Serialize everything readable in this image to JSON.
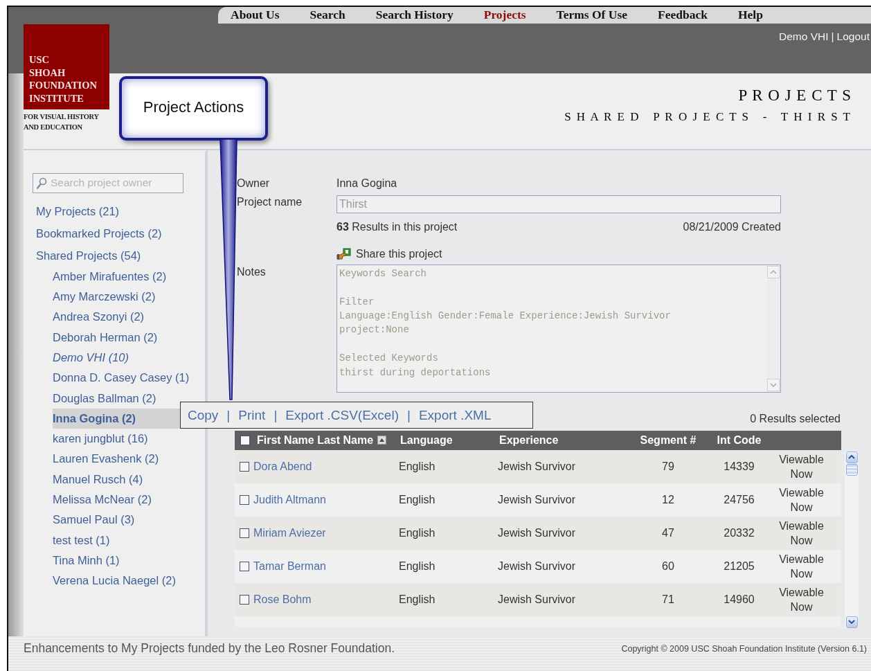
{
  "nav": [
    {
      "label": "About Us",
      "selected": false
    },
    {
      "label": "Search",
      "selected": false
    },
    {
      "label": "Search History",
      "selected": false
    },
    {
      "label": "Projects",
      "selected": true
    },
    {
      "label": "Terms Of Use",
      "selected": false
    },
    {
      "label": "Feedback",
      "selected": false
    },
    {
      "label": "Help",
      "selected": false
    }
  ],
  "user_links": {
    "user": "Demo VHI",
    "separator": "|",
    "logout": "Logout"
  },
  "logo": {
    "lines": [
      "USC",
      "SHOAH",
      "FOUNDATION",
      "INSTITUTE"
    ],
    "tagline": [
      "FOR VISUAL HISTORY",
      "AND EDUCATION"
    ]
  },
  "page_title": "P R O J E C T S",
  "page_subtitle": "S H A R E D   P R O J E C T S   -   T H I R S T",
  "callout": {
    "text": "Project Actions"
  },
  "sidebar": {
    "search": {
      "placeholder": "Search project owner"
    },
    "items": [
      {
        "label": "My Projects (21)",
        "selected": false
      },
      {
        "label": "Bookmarked Projects (2)",
        "selected": false
      },
      {
        "label": "Shared Projects (54)",
        "selected": false,
        "children": [
          {
            "label": "Amber Mirafuentes (2)",
            "kind": "owner",
            "selected": false
          },
          {
            "label": "Amy Marczewski (2)",
            "kind": "owner",
            "selected": false
          },
          {
            "label": "Andrea Szonyi (2)",
            "kind": "owner",
            "selected": false
          },
          {
            "label": "Deborah Herman (2)",
            "kind": "owner",
            "selected": false
          },
          {
            "label": "Demo VHI (10)",
            "kind": "self",
            "selected": false
          },
          {
            "label": "Donna D. Casey Casey (1)",
            "kind": "owner",
            "selected": false
          },
          {
            "label": "Douglas Ballman (2)",
            "kind": "owner",
            "selected": false
          },
          {
            "label": "Inna Gogina (2)",
            "kind": "owner",
            "selected": true
          },
          {
            "label": "karen jungblut (16)",
            "kind": "owner",
            "selected": false
          },
          {
            "label": "Lauren Evashenk (2)",
            "kind": "owner",
            "selected": false
          },
          {
            "label": "Manuel Rusch (4)",
            "kind": "owner",
            "selected": false
          },
          {
            "label": "Melissa McNear (2)",
            "kind": "owner",
            "selected": false
          },
          {
            "label": "Samuel Paul (3)",
            "kind": "owner",
            "selected": false
          },
          {
            "label": "test test (1)",
            "kind": "owner",
            "selected": false
          },
          {
            "label": "Tina Minh (1)",
            "kind": "owner",
            "selected": false
          },
          {
            "label": "Verena Lucia Naegel (2)",
            "kind": "owner",
            "selected": false
          }
        ]
      }
    ]
  },
  "project": {
    "owner_label": "Owner",
    "owner": "Inna Gogina",
    "name_label": "Project name",
    "name_value": "Thirst",
    "results": "**63** Results in this project",
    "created": "08/21/2009 Created",
    "share": "Share this project",
    "notes_label": "Notes",
    "notes": "Keywords Search\n\nFilter\nLanguage:English Gender:Female Experience:Jewish Survivor\nproject:None\n\nSelected Keywords\nthirst during deportations"
  },
  "actions": {
    "separator": "|",
    "items": [
      "Copy",
      "Print",
      "Export .CSV(Excel)",
      "Export .XML"
    ]
  },
  "results_selected": "0 Results selected",
  "table": {
    "select_all_checked": false,
    "columns": [
      {
        "label": "First Name Last Name",
        "sorted": true
      },
      {
        "label": "Language",
        "sorted": false
      },
      {
        "label": "Experience",
        "sorted": false
      },
      {
        "label": "Segment #",
        "sorted": false
      },
      {
        "label": "Int Code",
        "sorted": false
      }
    ],
    "rows": [
      {
        "checked": false,
        "name": "Dora Abend",
        "language": "English",
        "experience": "Jewish Survivor",
        "segment": "79",
        "int_code": "14339",
        "status": "Viewable Now"
      },
      {
        "checked": false,
        "name": "Judith Altmann",
        "language": "English",
        "experience": "Jewish Survivor",
        "segment": "12",
        "int_code": "24756",
        "status": "Viewable Now"
      },
      {
        "checked": false,
        "name": "Miriam Aviezer",
        "language": "English",
        "experience": "Jewish Survivor",
        "segment": "47",
        "int_code": "20332",
        "status": "Viewable Now"
      },
      {
        "checked": false,
        "name": "Tamar Berman",
        "language": "English",
        "experience": "Jewish Survivor",
        "segment": "60",
        "int_code": "21205",
        "status": "Viewable Now"
      },
      {
        "checked": false,
        "name": "Rose Bohm",
        "language": "English",
        "experience": "Jewish Survivor",
        "segment": "71",
        "int_code": "14960",
        "status": "Viewable Now"
      }
    ]
  },
  "footer": {
    "credit": "Enhancements to My Projects funded by the Leo Rosner Foundation.",
    "copyright": "Copyright © 2009 USC Shoah Foundation Institute (Version 6.1)"
  }
}
